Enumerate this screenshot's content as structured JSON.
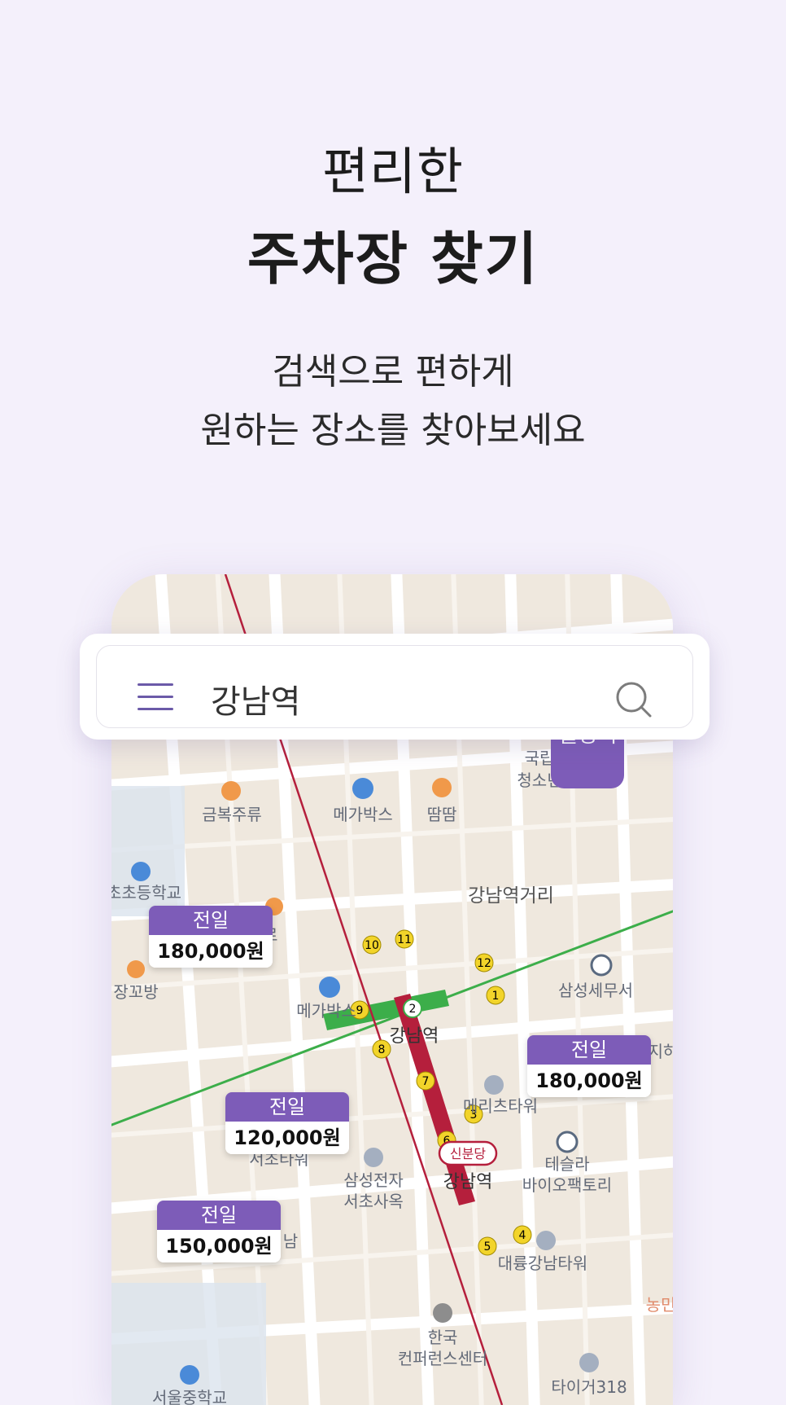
{
  "headline": {
    "line1": "편리한",
    "line2": "주차장 찾기"
  },
  "subtitle": {
    "line1": "검색으로 편하게",
    "line2": "원하는 장소를 찾아보세요"
  },
  "search": {
    "query": "강남역"
  },
  "map": {
    "station_badge": "월정액",
    "pois": {
      "restaurant1": "금복주류",
      "megabox1": "메가박스",
      "restaurant2": "땀땀",
      "school": "초초등학교",
      "cafe": "타르",
      "restaurant3": "장꼬방",
      "megabox2": "메가박스",
      "area": "강남역거리",
      "tax_office": "삼성세무서",
      "national1": "국립",
      "national2": "청소년",
      "building_edge": "지하",
      "station_main": "강남역",
      "station_line": "신분당",
      "station_label2": "강남역",
      "meritz": "메리츠타워",
      "seocho_tower": "서초타워",
      "samsung1": "삼성전자",
      "samsung2": "서초사옥",
      "tesla1": "테슬라",
      "tesla2": "바이오팩토리",
      "daeryung": "대륭강남타워",
      "nam": "남",
      "conf1": "한국",
      "conf2": "컨퍼런스센터",
      "nongmin": "농민",
      "tower318": "타이거318",
      "seoul_school": "서울중학교"
    },
    "exits": [
      "1",
      "2",
      "3",
      "4",
      "5",
      "6",
      "7",
      "8",
      "9",
      "10",
      "11",
      "12"
    ],
    "price_tags": [
      {
        "label": "전일",
        "price": "180,000원"
      },
      {
        "label": "전일",
        "price": "180,000원"
      },
      {
        "label": "전일",
        "price": "120,000원"
      },
      {
        "label": "전일",
        "price": "150,000원"
      }
    ]
  },
  "colors": {
    "background": "#f4f0fb",
    "accent": "#7d5cb8",
    "line2_green": "#3cae4a",
    "sinbundang_red": "#b51f3c",
    "exit_yellow": "#f2d42a"
  }
}
